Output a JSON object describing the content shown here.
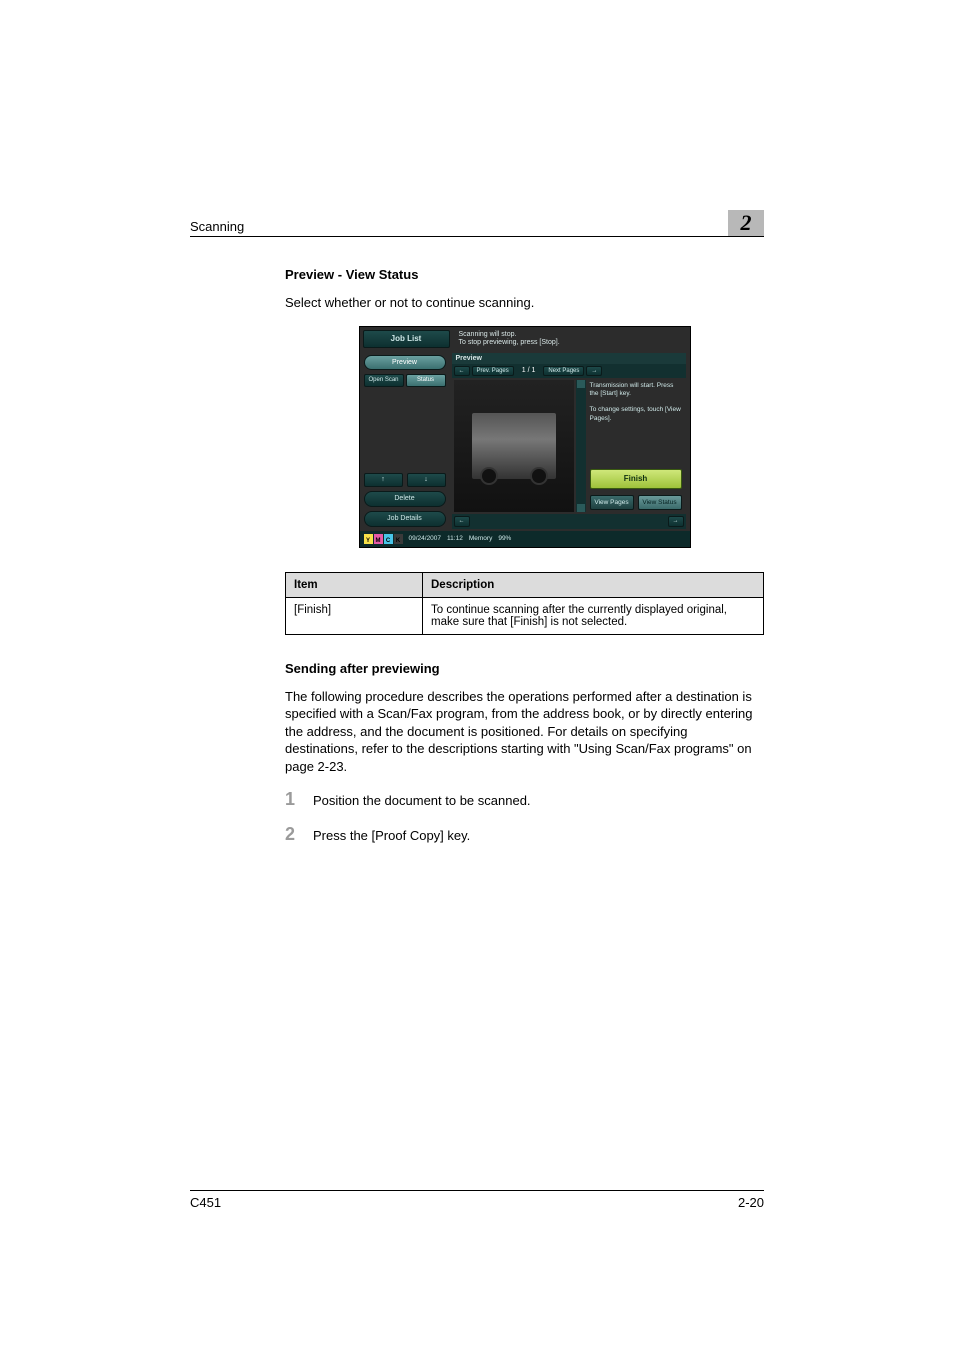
{
  "header": {
    "section": "Scanning",
    "chapter_number": "2"
  },
  "section": {
    "title": "Preview - View Status",
    "intro": "Select whether or not to continue scanning."
  },
  "device_screen": {
    "job_list": "Job List",
    "top_message_1": "Scanning will stop.",
    "top_message_2": "To stop previewing, press [Stop].",
    "left": {
      "preview_btn": "Preview",
      "tab_open_scan": "Open\nScan",
      "tab_status": "Status",
      "arrow_up": "↑",
      "arrow_down": "↓",
      "delete_btn": "Delete",
      "job_details_btn": "Job Details"
    },
    "preview_panel": {
      "label": "Preview",
      "prev_pages": "Prev.\nPages",
      "next_pages": "Next\nPages",
      "arrow_left": "←",
      "arrow_right": "→",
      "page_indicator": "1 /    1"
    },
    "side_panel": {
      "msg1": "Transmission will start. Press the [Start] key.",
      "msg2": "To change settings, touch [View Pages].",
      "finish": "Finish",
      "view_pages": "View Pages",
      "view_status": "View Status"
    },
    "status_bar": {
      "date": "09/24/2007",
      "time": "11:12",
      "memory_label": "Memory",
      "memory_value": "99%"
    },
    "toner": {
      "y": "Y",
      "m": "M",
      "c": "C",
      "k": "K"
    }
  },
  "table": {
    "headers": {
      "item": "Item",
      "description": "Description"
    },
    "rows": [
      {
        "item": "[Finish]",
        "description": "To continue scanning after the currently displayed original, make sure that [Finish] is not selected."
      }
    ]
  },
  "section2": {
    "title": "Sending after previewing",
    "para": "The following procedure describes the operations performed after a destination is specified with a Scan/Fax program, from the address book, or by directly entering the address, and the document is positioned. For details on specifying destinations, refer to the descriptions starting with \"Using Scan/Fax programs\" on page 2-23.",
    "steps": [
      {
        "n": "1",
        "text": "Position the document to be scanned."
      },
      {
        "n": "2",
        "text": "Press the [Proof Copy] key."
      }
    ]
  },
  "footer": {
    "model": "C451",
    "page": "2-20"
  }
}
